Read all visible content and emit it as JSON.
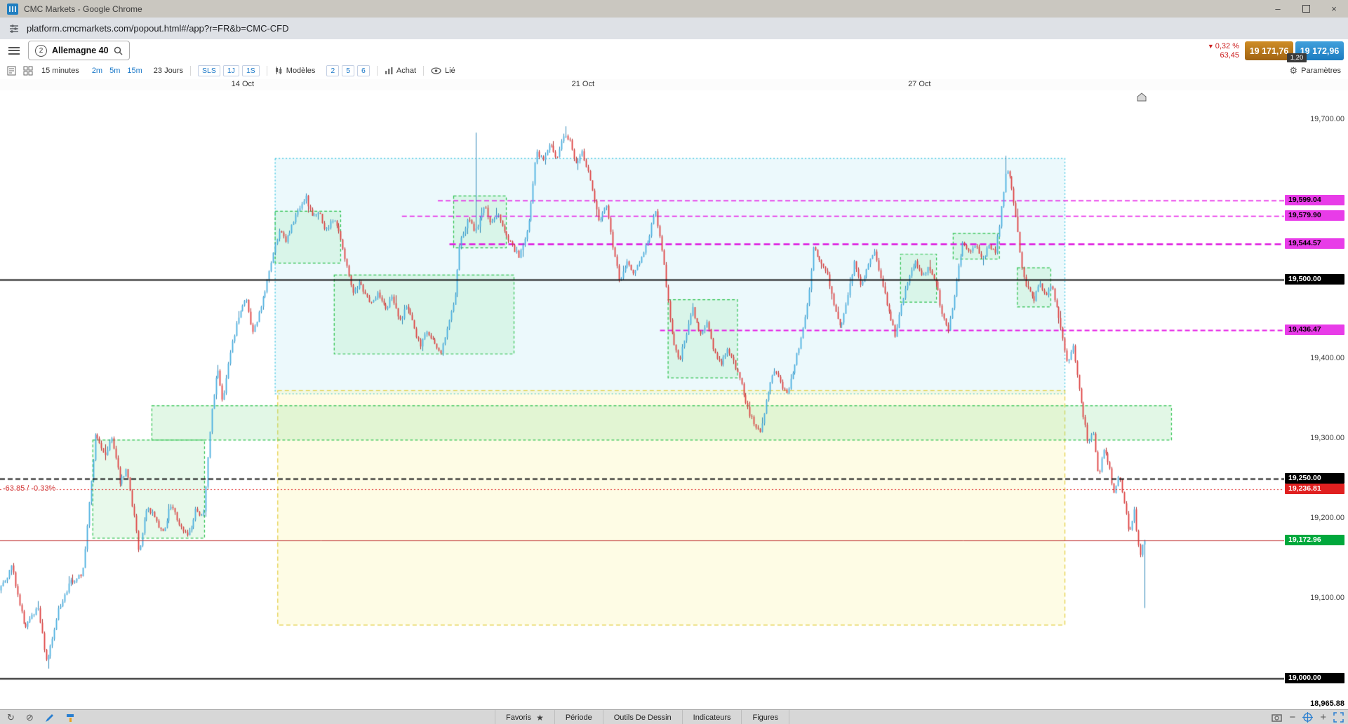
{
  "window": {
    "title": "CMC Markets - Google Chrome",
    "controls": {
      "minimize": "–",
      "close": "×"
    }
  },
  "address_bar": {
    "url": "platform.cmcmarkets.com/popout.html#/app?r=FR&b=CMC-CFD"
  },
  "glyphs": {
    "triangle_down": "▼",
    "refresh": "↻",
    "block": "⊘",
    "star": "★",
    "gear": "⚙"
  },
  "header": {
    "tab": {
      "badge": "2",
      "label": "Allemagne 40"
    },
    "quote": {
      "direction": "down",
      "change_pct": "0,32 %",
      "change_abs": "63,45",
      "sell": "19 171,76",
      "buy": "19 172,96",
      "spread": "1,20"
    }
  },
  "toolbar2": {
    "timeframe_label": "15 minutes",
    "quick_timeframes": [
      "2m",
      "5m",
      "15m"
    ],
    "period_label": "23 Jours",
    "scale_buttons": [
      "SLS",
      "1J",
      "1S"
    ],
    "models_label": "Modèles",
    "model_slots": [
      "2",
      "5",
      "6"
    ],
    "buy_mode_label": "Achat",
    "linked_label": "Lié",
    "settings_label": "Paramètres"
  },
  "bottom_bar": {
    "tabs": [
      "Favoris",
      "Période",
      "Outils De Dessin",
      "Indicateurs",
      "Figures"
    ]
  },
  "annotations": {
    "left_change_label": "-63.85 / -0.33%",
    "at_price": 19236.81
  },
  "chart_data": {
    "type": "candlestick",
    "instrument": "Allemagne 40",
    "timeframe": "15 minutes",
    "visible_range": "23 Jours",
    "x_date_labels": [
      {
        "label": "14 Oct",
        "f": 0.189
      },
      {
        "label": "21 Oct",
        "f": 0.454
      },
      {
        "label": "27 Oct",
        "f": 0.716
      }
    ],
    "y_axis": {
      "top_price": 19737,
      "bottom_price": 18961,
      "plain_ticks": [
        {
          "price": 19700,
          "label": "19,700.00"
        },
        {
          "price": 19400,
          "label": "19,400.00"
        },
        {
          "price": 19300,
          "label": "19,300.00"
        },
        {
          "price": 19200,
          "label": "19,200.00"
        },
        {
          "price": 19100,
          "label": "19,100.00"
        }
      ],
      "low_marker": {
        "price": 18965.88,
        "label": "18,965.88"
      }
    },
    "price_labels": [
      {
        "price": 19599.04,
        "label": "19,599.04",
        "bg": "#e83ce8",
        "fg": "#000000"
      },
      {
        "price": 19579.9,
        "label": "19,579.90",
        "bg": "#e83ce8",
        "fg": "#000000"
      },
      {
        "price": 19544.57,
        "label": "19,544.57",
        "bg": "#e83ce8",
        "fg": "#000000"
      },
      {
        "price": 19500.0,
        "label": "19,500.00",
        "bg": "#000000",
        "fg": "#ffffff"
      },
      {
        "price": 19436.47,
        "label": "19,436.47",
        "bg": "#e83ce8",
        "fg": "#000000"
      },
      {
        "price": 19250.0,
        "label": "19,250.00",
        "bg": "#000000",
        "fg": "#ffffff"
      },
      {
        "price": 19236.81,
        "label": "19,236.81",
        "bg": "#e02020",
        "fg": "#ffffff"
      },
      {
        "price": 19172.96,
        "label": "19,172.96",
        "bg": "#00a83c",
        "fg": "#ffffff"
      },
      {
        "price": 19000.0,
        "label": "19,000.00",
        "bg": "#000000",
        "fg": "#ffffff"
      }
    ],
    "h_lines": [
      {
        "price": 19599.04,
        "color": "#e61ae6",
        "style": "dash",
        "width": 1.5,
        "from": 0.341,
        "layer": "under"
      },
      {
        "price": 19579.9,
        "color": "#e61ae6",
        "style": "dash",
        "width": 1.5,
        "from": 0.313,
        "layer": "under"
      },
      {
        "price": 19544.57,
        "color": "#de12de",
        "style": "dash",
        "width": 2.5,
        "from": 0.35,
        "layer": "under"
      },
      {
        "price": 19436.47,
        "color": "#e61ae6",
        "style": "dash",
        "width": 2,
        "from": 0.514,
        "layer": "under"
      },
      {
        "price": 19500,
        "color": "#111111",
        "style": "solid",
        "width": 2,
        "from": 0,
        "layer": "over"
      },
      {
        "price": 19250,
        "color": "#111111",
        "style": "dash",
        "width": 2,
        "from": 0,
        "layer": "over"
      },
      {
        "price": 19236.81,
        "color": "#e02222",
        "style": "dot",
        "width": 1,
        "from": 0,
        "layer": "over"
      },
      {
        "price": 19172.96,
        "color": "#c23a3a",
        "style": "solid",
        "width": 1,
        "from": 0,
        "layer": "over"
      },
      {
        "price": 19000,
        "color": "#111111",
        "style": "solid",
        "width": 2,
        "from": 0,
        "layer": "over"
      }
    ],
    "zones": [
      {
        "name": "range-box-blue",
        "x0": 0.214,
        "x1": 0.829,
        "p0": 19652,
        "p1": 19357,
        "stroke": "#2fc0de",
        "fill": "rgba(100,205,230,0.12)",
        "dash": [
          2,
          3
        ]
      },
      {
        "name": "range-box-yellow",
        "x0": 0.216,
        "x1": 0.829,
        "p0": 19361,
        "p1": 19067,
        "stroke": "#e2cd3e",
        "fill": "rgba(252,244,170,0.30)",
        "dash": [
          6,
          4
        ]
      },
      {
        "name": "zone-green-wide",
        "x0": 0.118,
        "x1": 0.912,
        "p0": 19342,
        "p1": 19299,
        "stroke": "#2cc24e",
        "fill": "rgba(140,225,155,0.25)",
        "dash": [
          4,
          3
        ]
      },
      {
        "name": "zone-green-1",
        "x0": 0.072,
        "x1": 0.159,
        "p0": 19299,
        "p1": 19176,
        "stroke": "#2cc24e",
        "fill": "rgba(140,225,155,0.20)",
        "dash": [
          4,
          3
        ]
      },
      {
        "name": "zone-green-2",
        "x0": 0.214,
        "x1": 0.265,
        "p0": 19586,
        "p1": 19521,
        "stroke": "#2cc24e",
        "fill": "rgba(140,225,155,0.20)",
        "dash": [
          4,
          3
        ]
      },
      {
        "name": "zone-green-3",
        "x0": 0.26,
        "x1": 0.4,
        "p0": 19506,
        "p1": 19407,
        "stroke": "#2cc24e",
        "fill": "rgba(140,225,155,0.20)",
        "dash": [
          4,
          3
        ]
      },
      {
        "name": "zone-green-4",
        "x0": 0.353,
        "x1": 0.394,
        "p0": 19605,
        "p1": 19540,
        "stroke": "#2cc24e",
        "fill": "rgba(140,225,155,0.20)",
        "dash": [
          4,
          3
        ]
      },
      {
        "name": "zone-green-5",
        "x0": 0.52,
        "x1": 0.574,
        "p0": 19475,
        "p1": 19377,
        "stroke": "#2cc24e",
        "fill": "rgba(140,225,155,0.20)",
        "dash": [
          4,
          3
        ]
      },
      {
        "name": "zone-green-6",
        "x0": 0.701,
        "x1": 0.729,
        "p0": 19532,
        "p1": 19472,
        "stroke": "#2cc24e",
        "fill": "rgba(140,225,155,0.20)",
        "dash": [
          4,
          3
        ]
      },
      {
        "name": "zone-green-7",
        "x0": 0.742,
        "x1": 0.778,
        "p0": 19558,
        "p1": 19526,
        "stroke": "#2cc24e",
        "fill": "rgba(140,225,155,0.20)",
        "dash": [
          4,
          3
        ]
      },
      {
        "name": "zone-green-8",
        "x0": 0.792,
        "x1": 0.818,
        "p0": 19515,
        "p1": 19466,
        "stroke": "#2cc24e",
        "fill": "rgba(140,225,155,0.20)",
        "dash": [
          4,
          3
        ]
      }
    ],
    "path_anchors": [
      [
        0,
        19110
      ],
      [
        0.01,
        19140
      ],
      [
        0.02,
        19062
      ],
      [
        0.03,
        19092
      ],
      [
        0.037,
        19016
      ],
      [
        0.046,
        19086
      ],
      [
        0.055,
        19120
      ],
      [
        0.065,
        19132
      ],
      [
        0.075,
        19305
      ],
      [
        0.082,
        19280
      ],
      [
        0.088,
        19302
      ],
      [
        0.094,
        19246
      ],
      [
        0.099,
        19262
      ],
      [
        0.105,
        19202
      ],
      [
        0.109,
        19156
      ],
      [
        0.115,
        19216
      ],
      [
        0.122,
        19200
      ],
      [
        0.127,
        19182
      ],
      [
        0.134,
        19218
      ],
      [
        0.141,
        19190
      ],
      [
        0.147,
        19178
      ],
      [
        0.153,
        19210
      ],
      [
        0.159,
        19200
      ],
      [
        0.165,
        19330
      ],
      [
        0.17,
        19390
      ],
      [
        0.174,
        19346
      ],
      [
        0.181,
        19420
      ],
      [
        0.187,
        19455
      ],
      [
        0.192,
        19480
      ],
      [
        0.197,
        19432
      ],
      [
        0.202,
        19456
      ],
      [
        0.207,
        19486
      ],
      [
        0.213,
        19530
      ],
      [
        0.218,
        19560
      ],
      [
        0.223,
        19548
      ],
      [
        0.229,
        19572
      ],
      [
        0.234,
        19592
      ],
      [
        0.239,
        19602
      ],
      [
        0.244,
        19576
      ],
      [
        0.249,
        19586
      ],
      [
        0.254,
        19562
      ],
      [
        0.26,
        19576
      ],
      [
        0.265,
        19558
      ],
      [
        0.27,
        19520
      ],
      [
        0.276,
        19482
      ],
      [
        0.281,
        19497
      ],
      [
        0.288,
        19470
      ],
      [
        0.294,
        19482
      ],
      [
        0.301,
        19462
      ],
      [
        0.306,
        19480
      ],
      [
        0.312,
        19446
      ],
      [
        0.317,
        19466
      ],
      [
        0.323,
        19440
      ],
      [
        0.328,
        19416
      ],
      [
        0.333,
        19436
      ],
      [
        0.339,
        19420
      ],
      [
        0.344,
        19408
      ],
      [
        0.349,
        19442
      ],
      [
        0.355,
        19478
      ],
      [
        0.359,
        19548
      ],
      [
        0.365,
        19576
      ],
      [
        0.371,
        19560
      ],
      [
        0.378,
        19592
      ],
      [
        0.383,
        19570
      ],
      [
        0.388,
        19586
      ],
      [
        0.394,
        19556
      ],
      [
        0.399,
        19544
      ],
      [
        0.405,
        19528
      ],
      [
        0.412,
        19562
      ],
      [
        0.418,
        19660
      ],
      [
        0.424,
        19648
      ],
      [
        0.429,
        19668
      ],
      [
        0.434,
        19652
      ],
      [
        0.44,
        19684
      ],
      [
        0.444,
        19676
      ],
      [
        0.449,
        19642
      ],
      [
        0.454,
        19660
      ],
      [
        0.46,
        19626
      ],
      [
        0.467,
        19572
      ],
      [
        0.473,
        19596
      ],
      [
        0.478,
        19540
      ],
      [
        0.483,
        19498
      ],
      [
        0.489,
        19520
      ],
      [
        0.495,
        19508
      ],
      [
        0.5,
        19530
      ],
      [
        0.505,
        19548
      ],
      [
        0.511,
        19586
      ],
      [
        0.516,
        19540
      ],
      [
        0.521,
        19468
      ],
      [
        0.525,
        19420
      ],
      [
        0.53,
        19400
      ],
      [
        0.535,
        19432
      ],
      [
        0.54,
        19462
      ],
      [
        0.546,
        19428
      ],
      [
        0.551,
        19446
      ],
      [
        0.556,
        19412
      ],
      [
        0.562,
        19392
      ],
      [
        0.567,
        19412
      ],
      [
        0.572,
        19396
      ],
      [
        0.578,
        19368
      ],
      [
        0.583,
        19338
      ],
      [
        0.588,
        19318
      ],
      [
        0.593,
        19306
      ],
      [
        0.598,
        19352
      ],
      [
        0.604,
        19390
      ],
      [
        0.609,
        19368
      ],
      [
        0.614,
        19354
      ],
      [
        0.619,
        19392
      ],
      [
        0.624,
        19424
      ],
      [
        0.63,
        19475
      ],
      [
        0.634,
        19540
      ],
      [
        0.64,
        19522
      ],
      [
        0.645,
        19505
      ],
      [
        0.651,
        19462
      ],
      [
        0.655,
        19438
      ],
      [
        0.661,
        19482
      ],
      [
        0.666,
        19522
      ],
      [
        0.671,
        19492
      ],
      [
        0.677,
        19522
      ],
      [
        0.682,
        19532
      ],
      [
        0.687,
        19498
      ],
      [
        0.693,
        19458
      ],
      [
        0.698,
        19428
      ],
      [
        0.703,
        19472
      ],
      [
        0.708,
        19502
      ],
      [
        0.713,
        19522
      ],
      [
        0.719,
        19506
      ],
      [
        0.724,
        19516
      ],
      [
        0.73,
        19494
      ],
      [
        0.734,
        19458
      ],
      [
        0.739,
        19438
      ],
      [
        0.744,
        19482
      ],
      [
        0.75,
        19546
      ],
      [
        0.755,
        19536
      ],
      [
        0.76,
        19542
      ],
      [
        0.766,
        19526
      ],
      [
        0.771,
        19542
      ],
      [
        0.776,
        19536
      ],
      [
        0.78,
        19582
      ],
      [
        0.784,
        19640
      ],
      [
        0.787,
        19628
      ],
      [
        0.79,
        19596
      ],
      [
        0.794,
        19548
      ],
      [
        0.797,
        19508
      ],
      [
        0.801,
        19488
      ],
      [
        0.806,
        19476
      ],
      [
        0.81,
        19496
      ],
      [
        0.815,
        19482
      ],
      [
        0.82,
        19490
      ],
      [
        0.824,
        19458
      ],
      [
        0.828,
        19430
      ],
      [
        0.832,
        19396
      ],
      [
        0.836,
        19416
      ],
      [
        0.84,
        19378
      ],
      [
        0.844,
        19330
      ],
      [
        0.848,
        19295
      ],
      [
        0.852,
        19312
      ],
      [
        0.856,
        19252
      ],
      [
        0.86,
        19288
      ],
      [
        0.864,
        19270
      ],
      [
        0.868,
        19232
      ],
      [
        0.872,
        19256
      ],
      [
        0.876,
        19222
      ],
      [
        0.88,
        19182
      ],
      [
        0.884,
        19212
      ],
      [
        0.888,
        19152
      ],
      [
        0.892,
        19173
      ]
    ],
    "spikes": [
      {
        "f": 0.037,
        "type": "low",
        "price": 19012
      },
      {
        "f": 0.37,
        "type": "high",
        "price": 19684
      },
      {
        "f": 0.441,
        "type": "high",
        "price": 19692
      },
      {
        "f": 0.784,
        "type": "high",
        "price": 19655
      },
      {
        "f": 0.892,
        "type": "low",
        "price": 19088
      }
    ],
    "last_price": 19172.96,
    "candle_count": 560,
    "last_x_frac": 0.892,
    "colors": {
      "up": "#4aafe0",
      "down": "#de4040",
      "wick_up": "#3089b8",
      "wick_down": "#b03434"
    }
  }
}
